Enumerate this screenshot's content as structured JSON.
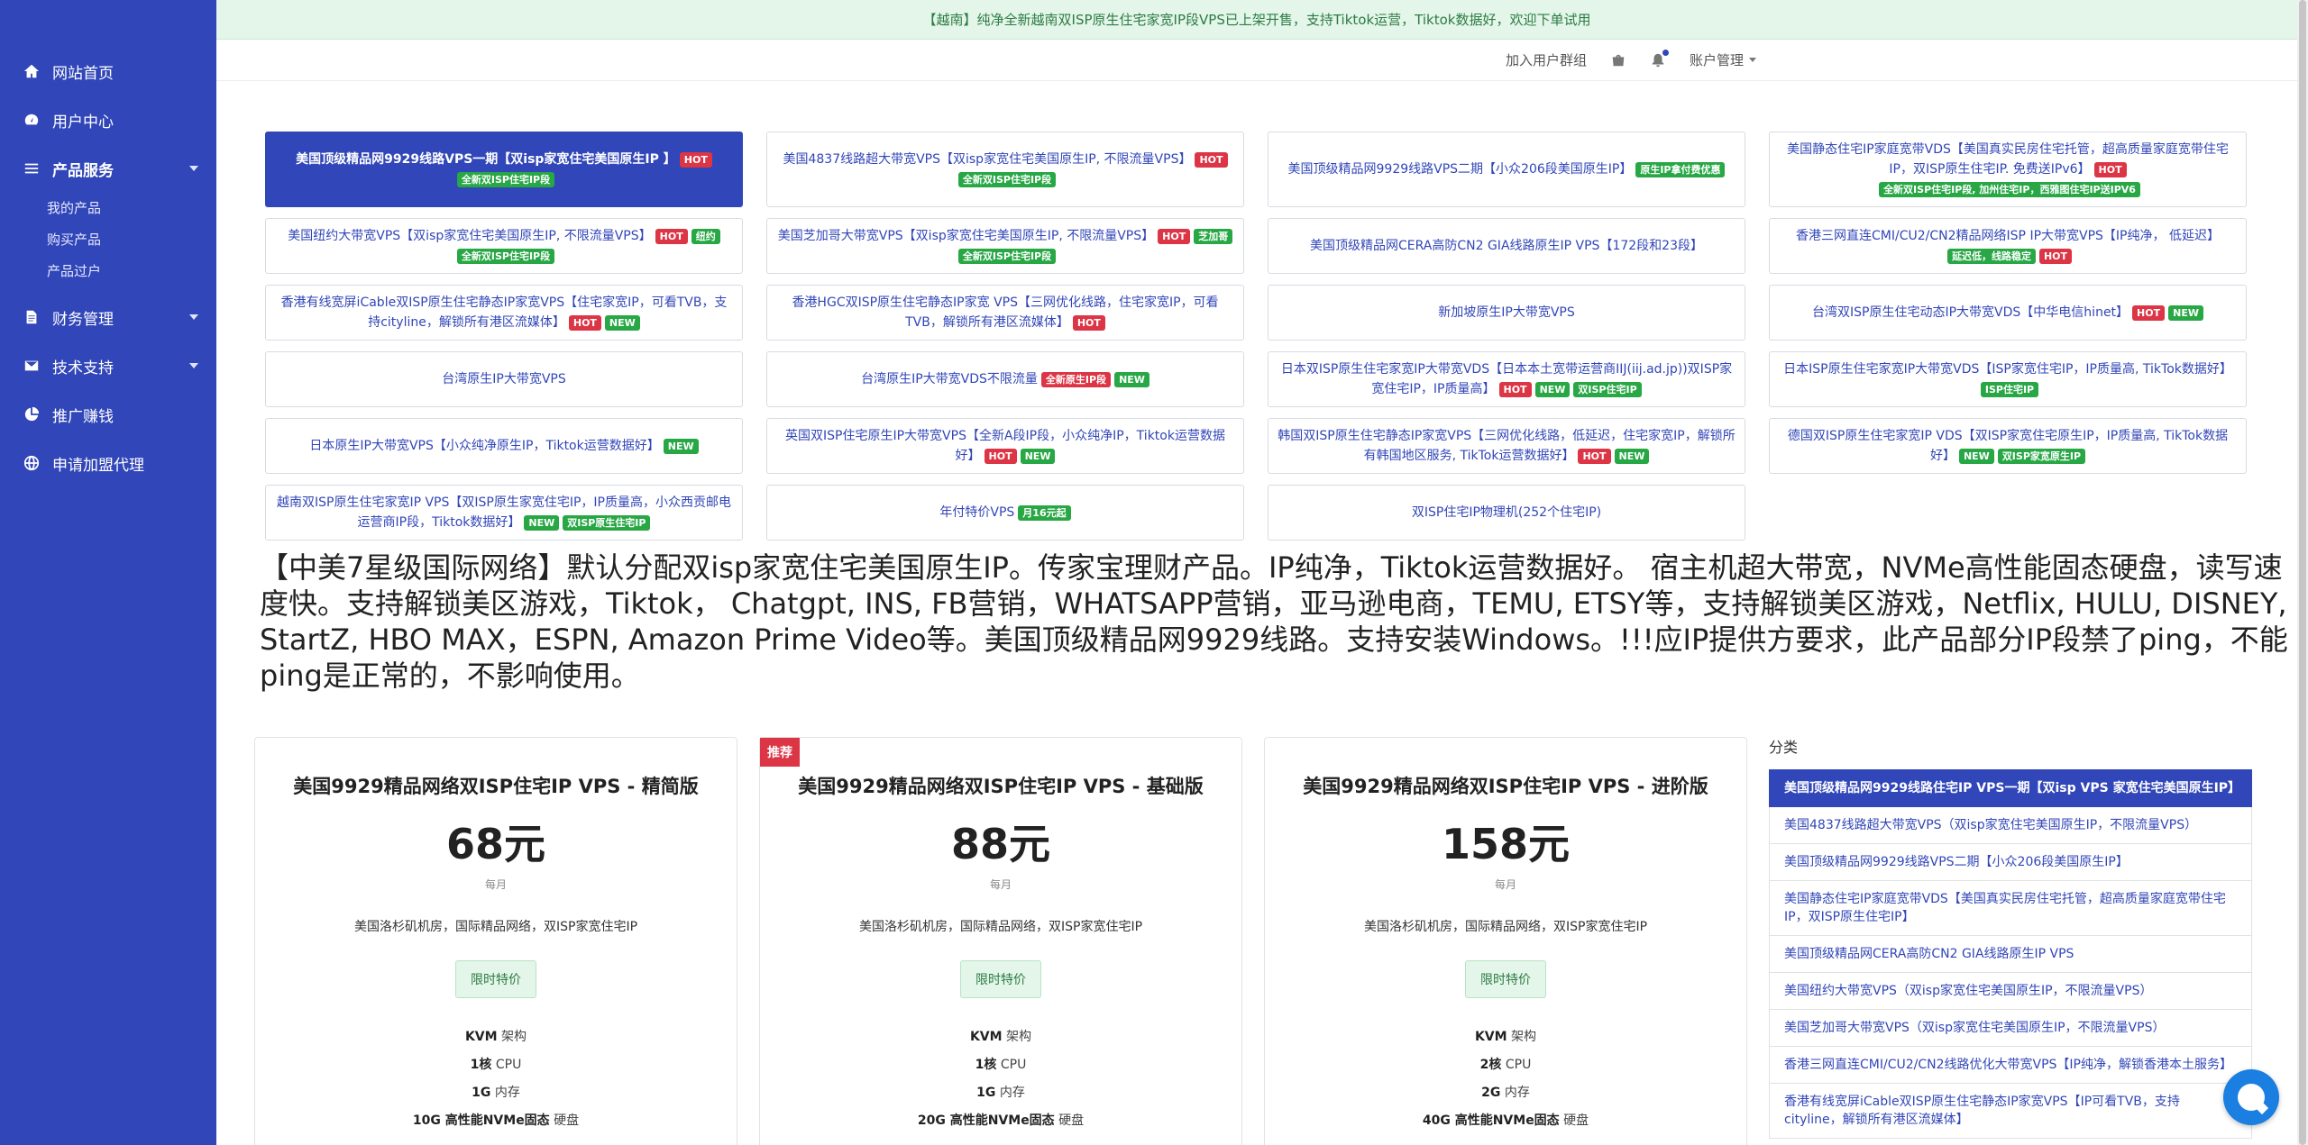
{
  "sidebar": {
    "items": [
      {
        "label": "网站首页",
        "icon": "home-icon"
      },
      {
        "label": "用户中心",
        "icon": "dashboard-icon"
      },
      {
        "label": "产品服务",
        "icon": "list-icon"
      },
      {
        "label": "财务管理",
        "icon": "document-icon"
      },
      {
        "label": "技术支持",
        "icon": "mail-icon"
      },
      {
        "label": "推广赚钱",
        "icon": "pie-chart-icon"
      },
      {
        "label": "申请加盟代理",
        "icon": "globe-icon"
      }
    ],
    "sub_items": [
      "我的产品",
      "购买产品",
      "产品过户"
    ]
  },
  "notice": "【越南】纯净全新越南双ISP原生住宅家宽IP段VPS已上架开售，支持Tiktok运营，Tiktok数据好，欢迎下单试用",
  "topbar": {
    "join_group": "加入用户群组",
    "account": "账户管理"
  },
  "categories": [
    {
      "text": "美国顶级精品网9929线路VPS一期【双isp家宽住宅美国原生IP 】",
      "badges": [
        {
          "t": "HOT",
          "c": "red"
        },
        {
          "t": "全新双ISP住宅IP段",
          "c": "green"
        }
      ]
    },
    {
      "text": "美国4837线路超大带宽VPS【双isp家宽住宅美国原生IP, 不限流量VPS】",
      "badges": [
        {
          "t": "HOT",
          "c": "red"
        },
        {
          "t": "全新双ISP住宅IP段",
          "c": "green"
        }
      ]
    },
    {
      "text": "美国顶级精品网9929线路VPS二期【小众206段美国原生IP】",
      "badges": [
        {
          "t": "原生IP拿付费优惠",
          "c": "green"
        }
      ]
    },
    {
      "text": "美国静态住宅IP家庭宽带VDS【美国真实民房住宅托管，超高质量家庭宽带住宅IP，双ISP原生住宅IP. 免费送IPv6】",
      "badges": [
        {
          "t": "HOT",
          "c": "red"
        },
        {
          "t": "全新双ISP住宅IP段, 加州住宅IP，西雅图住宅IP送IPV6",
          "c": "green"
        }
      ]
    },
    {
      "text": "美国纽约大带宽VPS【双isp家宽住宅美国原生IP, 不限流量VPS】",
      "badges": [
        {
          "t": "HOT",
          "c": "red"
        },
        {
          "t": "纽约",
          "c": "green"
        },
        {
          "t": "全新双ISP住宅IP段",
          "c": "green"
        }
      ]
    },
    {
      "text": "美国芝加哥大带宽VPS【双isp家宽住宅美国原生IP, 不限流量VPS】",
      "badges": [
        {
          "t": "HOT",
          "c": "red"
        },
        {
          "t": "芝加哥",
          "c": "green"
        },
        {
          "t": "全新双ISP住宅IP段",
          "c": "green"
        }
      ]
    },
    {
      "text": "美国顶级精品网CERA高防CN2 GIA线路原生IP VPS【172段和23段】",
      "badges": []
    },
    {
      "text": "香港三网直连CMI/CU2/CN2精品网络ISP IP大带宽VPS【IP纯净， 低延迟】",
      "badges": [
        {
          "t": "延迟低，线路稳定",
          "c": "green"
        },
        {
          "t": "HOT",
          "c": "red"
        }
      ]
    },
    {
      "text": "香港有线宽屏iCable双ISP原生住宅静态IP家宽VPS【住宅家宽IP，可看TVB，支持cityline，解锁所有港区流媒体】",
      "badges": [
        {
          "t": "HOT",
          "c": "red"
        },
        {
          "t": "NEW",
          "c": "green"
        }
      ]
    },
    {
      "text": "香港HGC双ISP原生住宅静态IP家宽 VPS【三网优化线路，住宅家宽IP，可看TVB，解锁所有港区流媒体】",
      "badges": [
        {
          "t": "HOT",
          "c": "red"
        }
      ]
    },
    {
      "text": "新加坡原生IP大带宽VPS",
      "badges": []
    },
    {
      "text": "台湾双ISP原生住宅动态IP大带宽VDS【中华电信hinet】",
      "badges": [
        {
          "t": "HOT",
          "c": "red"
        },
        {
          "t": "NEW",
          "c": "green"
        }
      ]
    },
    {
      "text": "台湾原生IP大带宽VPS",
      "badges": []
    },
    {
      "text": "台湾原生IP大带宽VDS不限流量",
      "badges": [
        {
          "t": "全新原生IP段",
          "c": "red"
        },
        {
          "t": "NEW",
          "c": "green"
        }
      ]
    },
    {
      "text": "日本双ISP原生住宅家宽IP大带宽VDS【日本本土宽带运营商IIJ(iij.ad.jp))双ISP家宽住宅IP，IP质量高】",
      "badges": [
        {
          "t": "HOT",
          "c": "red"
        },
        {
          "t": "NEW",
          "c": "green"
        },
        {
          "t": "双ISP住宅IP",
          "c": "green"
        }
      ]
    },
    {
      "text": "日本ISP原生住宅家宽IP大带宽VDS【ISP家宽住宅IP，IP质量高, TikTok数据好】",
      "badges": [
        {
          "t": "ISP住宅IP",
          "c": "green"
        }
      ]
    },
    {
      "text": "日本原生IP大带宽VPS【小众纯净原生IP，Tiktok运营数据好】",
      "badges": [
        {
          "t": "NEW",
          "c": "green"
        }
      ]
    },
    {
      "text": "英国双ISP住宅原生IP大带宽VPS【全新A段IP段，小众纯净IP，Tiktok运营数据好】",
      "badges": [
        {
          "t": "HOT",
          "c": "red"
        },
        {
          "t": "NEW",
          "c": "green"
        }
      ]
    },
    {
      "text": "韩国双ISP原生住宅静态IP家宽VPS【三网优化线路，低延迟，住宅家宽IP，解锁所有韩国地区服务, TikTok运营数据好】",
      "badges": [
        {
          "t": "HOT",
          "c": "red"
        },
        {
          "t": "NEW",
          "c": "green"
        }
      ]
    },
    {
      "text": "德国双ISP原生住宅家宽IP VDS【双ISP家宽住宅原生IP，IP质量高, TikTok数据好】",
      "badges": [
        {
          "t": "NEW",
          "c": "green"
        },
        {
          "t": "双ISP家宽原生IP",
          "c": "green"
        }
      ]
    },
    {
      "text": "越南双ISP原生住宅家宽IP VPS【双ISP原生家宽住宅IP，IP质量高，小众西贡邮电运营商IP段，Tiktok数据好】",
      "badges": [
        {
          "t": "NEW",
          "c": "green"
        },
        {
          "t": "双ISP原生住宅IP",
          "c": "green"
        }
      ]
    },
    {
      "text": "年付特价VPS",
      "badges": [
        {
          "t": "月16元起",
          "c": "green"
        }
      ]
    },
    {
      "text": "双ISP住宅IP物理机(252个住宅IP)",
      "badges": []
    }
  ],
  "description": "【中美7星级国际网络】默认分配双isp家宽住宅美国原生IP。传家宝理财产品。IP纯净，Tiktok运营数据好。 宿主机超大带宽，NVMe高性能固态硬盘，读写速度快。支持解锁美区游戏，Tiktok， Chatgpt, INS, FB营销，WHATSAPP营销，亚马逊电商，TEMU, ETSY等，支持解锁美区游戏，Netflix, HULU, DISNEY, StartZ, HBO MAX，ESPN, Amazon Prime Video等。美国顶级精品网9929线路。支持安装Windows。!!!应IP提供方要求，此产品部分IP段禁了ping，不能ping是正常的，不影响使用。",
  "plans": [
    {
      "name": "美国9929精品网络双ISP住宅IP VPS - 精简版",
      "price": "68元",
      "period": "每月",
      "text": "美国洛杉矶机房，国际精品网络，双ISP家宽住宅IP",
      "promo": "限时特价",
      "recommended": "",
      "specs": [
        {
          "v": "KVM",
          "l": "架构"
        },
        {
          "v": "1核",
          "l": "CPU"
        },
        {
          "v": "1G",
          "l": "内存"
        },
        {
          "v": "10G 高性能NVMe固态",
          "l": "硬盘"
        }
      ]
    },
    {
      "name": "美国9929精品网络双ISP住宅IP VPS - 基础版",
      "price": "88元",
      "period": "每月",
      "text": "美国洛杉矶机房，国际精品网络，双ISP家宽住宅IP",
      "promo": "限时特价",
      "recommended": "推荐",
      "specs": [
        {
          "v": "KVM",
          "l": "架构"
        },
        {
          "v": "1核",
          "l": "CPU"
        },
        {
          "v": "1G",
          "l": "内存"
        },
        {
          "v": "20G 高性能NVMe固态",
          "l": "硬盘"
        }
      ]
    },
    {
      "name": "美国9929精品网络双ISP住宅IP VPS - 进阶版",
      "price": "158元",
      "period": "每月",
      "text": "美国洛杉矶机房，国际精品网络，双ISP家宽住宅IP",
      "promo": "限时特价",
      "recommended": "",
      "specs": [
        {
          "v": "KVM",
          "l": "架构"
        },
        {
          "v": "2核",
          "l": "CPU"
        },
        {
          "v": "2G",
          "l": "内存"
        },
        {
          "v": "40G 高性能NVMe固态",
          "l": "硬盘"
        }
      ]
    }
  ],
  "side": {
    "title": "分类",
    "items": [
      "美国顶级精品网9929线路住宅IP VPS一期【双isp VPS 家宽住宅美国原生IP】",
      "美国4837线路超大带宽VPS（双isp家宽住宅美国原生IP，不限流量VPS）",
      "美国顶级精品网9929线路VPS二期【小众206段美国原生IP】",
      "美国静态住宅IP家庭宽带VDS【美国真实民房住宅托管，超高质量家庭宽带住宅IP，双ISP原生住宅IP】",
      "美国顶级精品网CERA高防CN2 GIA线路原生IP VPS",
      "美国纽约大带宽VPS（双isp家宽住宅美国原生IP，不限流量VPS）",
      "美国芝加哥大带宽VPS（双isp家宽住宅美国原生IP，不限流量VPS）",
      "香港三网直连CMI/CU2/CN2线路优化大带宽VPS【IP纯净，解锁香港本土服务】",
      "香港有线宽屏iCable双ISP原生住宅静态IP家宽VPS【IP可看TVB，支持cityline，解锁所有港区流媒体】"
    ]
  }
}
